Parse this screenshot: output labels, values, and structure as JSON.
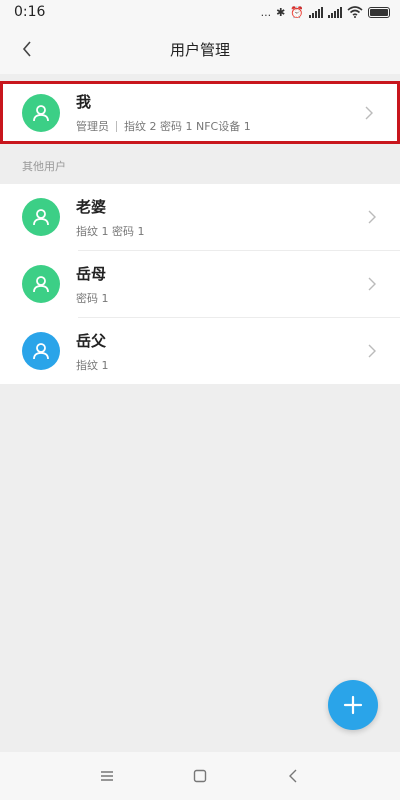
{
  "status_bar": {
    "time": "0:16",
    "dots": "...",
    "bluetooth": "✱",
    "alarm": "⏰"
  },
  "header": {
    "title": "用户管理"
  },
  "me": {
    "name": "我",
    "role": "管理员",
    "detail": "指纹 2  密码 1  NFC设备 1",
    "avatar_color": "#3ccf86",
    "highlight_color": "#c8161d"
  },
  "others": {
    "section_label": "其他用户",
    "users": [
      {
        "name": "老婆",
        "detail": "指纹 1  密码 1",
        "avatar_color": "#3ccf86"
      },
      {
        "name": "岳母",
        "detail": "密码 1",
        "avatar_color": "#3ccf86"
      },
      {
        "name": "岳父",
        "detail": "指纹 1",
        "avatar_color": "#2aa4e9"
      }
    ]
  },
  "fab": {
    "icon": "plus-icon",
    "color": "#2aa4e9"
  },
  "nav_bar": {
    "icons": [
      "menu-icon",
      "home-icon",
      "back-icon"
    ]
  }
}
